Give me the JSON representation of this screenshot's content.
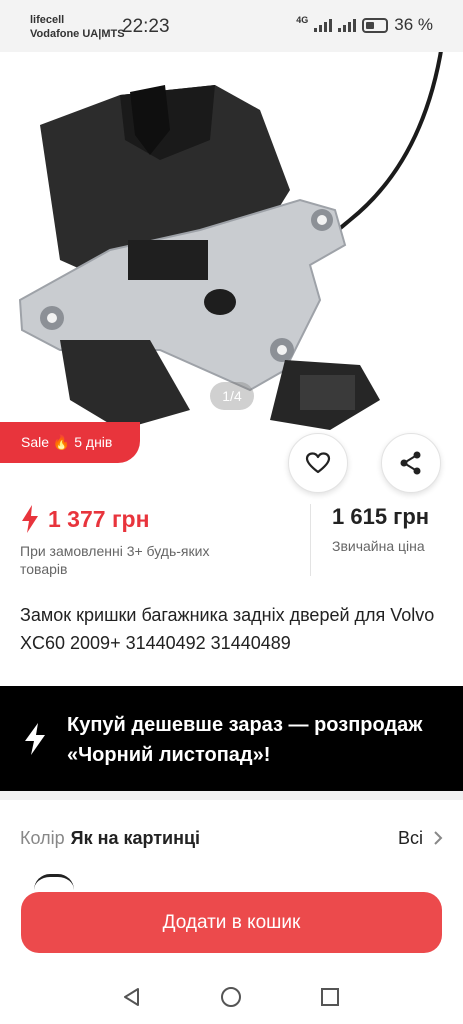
{
  "status_bar": {
    "carrier_1": "lifecell",
    "carrier_2": "Vodafone UA|MTS",
    "time": "22:23",
    "network": "4G",
    "battery": "36 %"
  },
  "gallery": {
    "pager": "1/4",
    "sale_badge": "Sale 🔥 5 днів"
  },
  "price": {
    "sale_price": "1 377 грн",
    "sale_note": "При замовленні 3+ будь-яких товарів",
    "regular_price": "1 615 грн",
    "regular_note": "Звичайна ціна"
  },
  "product": {
    "title": "Замок кришки багажника задніх дверей для Volvo XC60 2009+ 31440492 31440489"
  },
  "promo": {
    "text": "Купуй дешевше зараз — розпродаж «Чорний листопад»!"
  },
  "variant": {
    "label": "Колір",
    "value": "Як на картинці",
    "all_label": "Всі"
  },
  "actions": {
    "add_to_cart": "Додати в кошик"
  },
  "colors": {
    "accent": "#e8343c",
    "button": "#ec4a4c",
    "banner": "#000000"
  }
}
